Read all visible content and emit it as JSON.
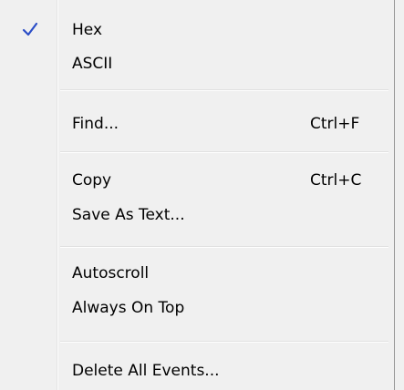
{
  "menu": {
    "items": [
      {
        "label": "Hex",
        "checked": true
      },
      {
        "label": "ASCII",
        "checked": false
      },
      {
        "label": "Find...",
        "shortcut": "Ctrl+F"
      },
      {
        "label": "Copy",
        "shortcut": "Ctrl+C"
      },
      {
        "label": "Save As Text..."
      },
      {
        "label": "Autoscroll"
      },
      {
        "label": "Always On Top"
      },
      {
        "label": "Delete All Events..."
      }
    ]
  },
  "colors": {
    "background": "#f0f0f0",
    "checkmark": "#2b4ec7",
    "text": "#000000"
  },
  "icons": {
    "check": "checkmark-icon"
  }
}
